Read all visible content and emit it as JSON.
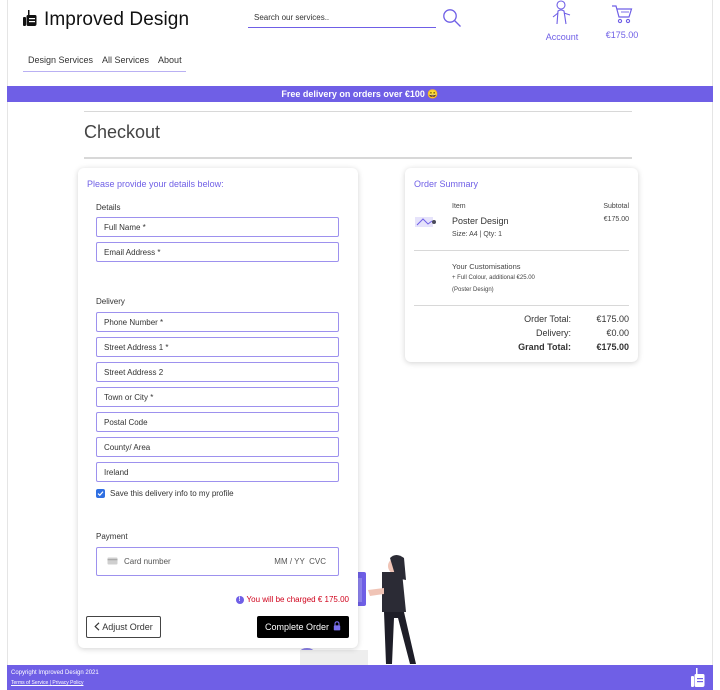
{
  "brand": {
    "name": "Improved Design"
  },
  "search": {
    "placeholder": "Search our services.."
  },
  "header": {
    "account_label": "Account",
    "cart_total": "€175.00"
  },
  "nav": {
    "items": [
      {
        "label": "Design Services"
      },
      {
        "label": "All Services"
      },
      {
        "label": "About"
      }
    ]
  },
  "banner": {
    "text": "Free delivery on orders over €100 😀"
  },
  "page": {
    "title": "Checkout"
  },
  "form": {
    "heading": "Please provide your details below:",
    "details_label": "Details",
    "full_name_placeholder": "Full Name *",
    "email_placeholder": "Email Address *",
    "delivery_label": "Delivery",
    "phone_placeholder": "Phone Number *",
    "street1_placeholder": "Street Address 1 *",
    "street2_placeholder": "Street Address 2",
    "town_placeholder": "Town or City *",
    "postal_placeholder": "Postal Code",
    "county_placeholder": "County/ Area",
    "country_value": "Ireland",
    "save_info_label": "Save this delivery info to my profile",
    "save_info_checked": true,
    "payment_label": "Payment",
    "card_number_placeholder": "Card number",
    "card_expiry_cvc": "MM / YY  CVC",
    "charge_text": "You will be charged € 175.00",
    "adjust_button": "Adjust Order",
    "complete_button": "Complete Order"
  },
  "summary": {
    "heading": "Order Summary",
    "col_item": "Item",
    "col_subtotal": "Subtotal",
    "product_name": "Poster Design",
    "product_meta": "Size: A4 | Qty: 1",
    "product_subtotal": "€175.00",
    "custom_heading": "Your Customisations",
    "custom_line1": "+ Full Colour, additional €25.00",
    "custom_line2": "(Poster Design)",
    "order_total_label": "Order Total:",
    "order_total_value": "€175.00",
    "delivery_label": "Delivery:",
    "delivery_value": "€0.00",
    "grand_total_label": "Grand Total:",
    "grand_total_value": "€175.00"
  },
  "footer": {
    "copyright": "Copyright Improved Design 2021",
    "terms": "Terms of Service",
    "separator": "|",
    "privacy": "Privacy Policy"
  },
  "colors": {
    "accent": "#6f5fe6",
    "charge_red": "#d0021b",
    "button_dark": "#000000"
  }
}
